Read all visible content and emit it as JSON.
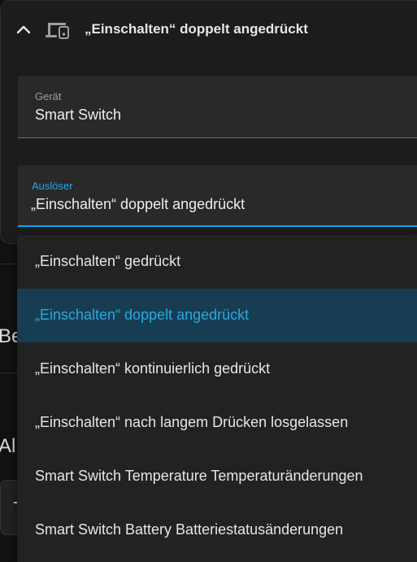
{
  "card": {
    "title": "„Einschalten“ doppelt angedrückt",
    "collapse_icon": "chevron-up-icon",
    "type_icon": "devices-icon"
  },
  "device_field": {
    "label": "Gerät",
    "value": "Smart Switch"
  },
  "trigger_field": {
    "label": "Auslöser",
    "value": "„Einschalten“ doppelt angedrückt"
  },
  "background": {
    "fragment_1": "Be",
    "fragment_2": "Al"
  },
  "dropdown": {
    "options": [
      {
        "label": "„Einschalten“ gedrückt",
        "selected": false
      },
      {
        "label": "„Einschalten“ doppelt angedrückt",
        "selected": true
      },
      {
        "label": "„Einschalten“ kontinuierlich gedrückt",
        "selected": false
      },
      {
        "label": "„Einschalten“ nach langem Drücken losgelassen",
        "selected": false
      },
      {
        "label": "Smart Switch Temperature Temperaturänderungen",
        "selected": false
      },
      {
        "label": "Smart Switch Battery Batteriestatusänderungen",
        "selected": false
      }
    ]
  },
  "colors": {
    "accent": "#03a9f4",
    "selected_bg": "#163d52",
    "surface": "#222222"
  }
}
